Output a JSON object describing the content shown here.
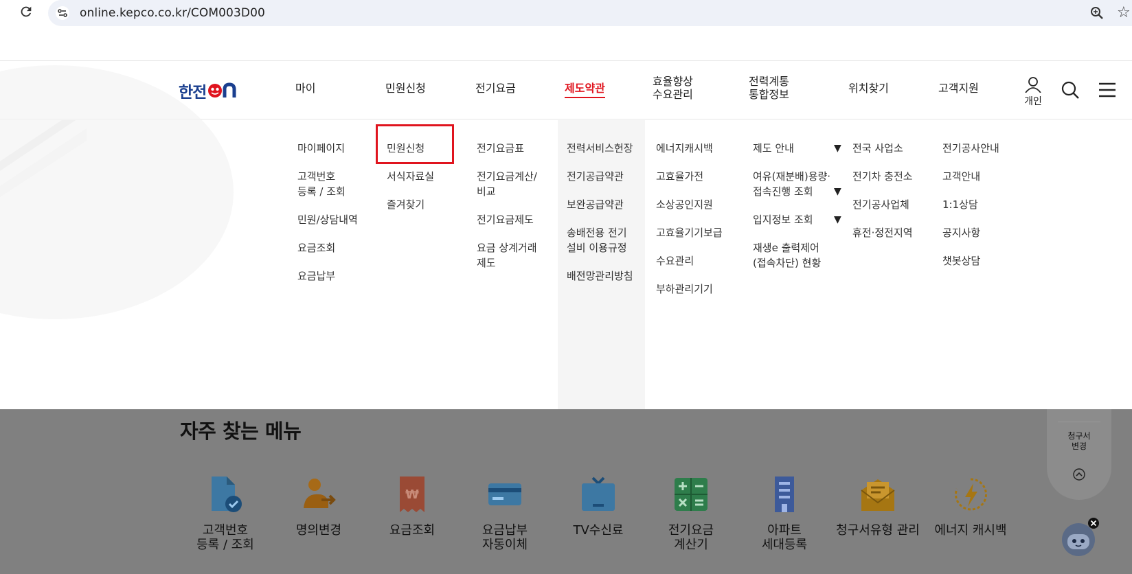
{
  "browser": {
    "url": "online.kepco.co.kr/COM003D00",
    "icons": [
      "reload-icon",
      "site-settings-icon",
      "zoom-icon",
      "bookmark-star-icon"
    ]
  },
  "header": {
    "logo_text": "한전",
    "logo_suffix": "ON",
    "nav": [
      {
        "label": "마이"
      },
      {
        "label": "민원신청"
      },
      {
        "label": "전기요금"
      },
      {
        "label": "제도약관",
        "active": true
      },
      {
        "label_line1": "효율향상",
        "label_line2": "수요관리"
      },
      {
        "label_line1": "전력계통",
        "label_line2": "통합정보"
      },
      {
        "label": "위치찾기"
      },
      {
        "label": "고객지원"
      }
    ],
    "personal_label": "개인",
    "accent_color": "#e0141e",
    "brand_color": "#1a3f8f"
  },
  "mega_menu": {
    "columns": [
      {
        "items": [
          [
            "마이페이지"
          ],
          [
            "고객번호",
            "등록 / 조회"
          ],
          [
            "민원/상담내역"
          ],
          [
            "요금조회"
          ],
          [
            "요금납부"
          ]
        ]
      },
      {
        "items": [
          [
            "민원신청"
          ],
          [
            "서식자료실"
          ],
          [
            "즐겨찾기"
          ]
        ]
      },
      {
        "items": [
          [
            "전기요금표"
          ],
          [
            "전기요금계산/",
            "비교"
          ],
          [
            "전기요금제도"
          ],
          [
            "요금 상계거래",
            "제도"
          ]
        ]
      },
      {
        "items": [
          [
            "전력서비스헌장"
          ],
          [
            "전기공급약관"
          ],
          [
            "보완공급약관"
          ],
          [
            "송배전용 전기",
            "설비 이용규정"
          ],
          [
            "배전망관리방침"
          ]
        ]
      },
      {
        "items": [
          [
            "에너지캐시백"
          ],
          [
            "고효율가전"
          ],
          [
            "소상공인지원"
          ],
          [
            "고효율기기보급"
          ],
          [
            "수요관리"
          ],
          [
            "부하관리기기"
          ]
        ]
      },
      {
        "items": [
          [
            "제도 안내"
          ],
          [
            "여유(재분배)용량·",
            "접속진행 조회"
          ],
          [
            "입지정보 조회"
          ],
          [
            "재생e 출력제어",
            "(접속차단) 현황"
          ]
        ],
        "arrow": "▼"
      },
      {
        "items": [
          [
            "전국 사업소"
          ],
          [
            "전기차 충전소"
          ],
          [
            "전기공사업체"
          ],
          [
            "휴전·정전지역"
          ]
        ]
      },
      {
        "items": [
          [
            "전기공사안내"
          ],
          [
            "고객안내"
          ],
          [
            "1:1상담"
          ],
          [
            "공지사항"
          ],
          [
            "챗봇상담"
          ]
        ]
      }
    ]
  },
  "frequent": {
    "title": "자주 찾는 메뉴",
    "items": [
      {
        "line1": "고객번호",
        "line2": "등록 / 조회",
        "icon": "document-check-icon"
      },
      {
        "line1": "명의변경",
        "line2": "",
        "icon": "person-transfer-icon"
      },
      {
        "line1": "요금조회",
        "line2": "",
        "icon": "won-receipt-icon"
      },
      {
        "line1": "요금납부",
        "line2": "자동이체",
        "icon": "credit-card-icon"
      },
      {
        "line1": "TV수신료",
        "line2": "",
        "icon": "tv-icon"
      },
      {
        "line1": "전기요금",
        "line2": "계산기",
        "icon": "calculator-icon"
      },
      {
        "line1": "아파트",
        "line2": "세대등록",
        "icon": "apartment-icon"
      },
      {
        "line1": "청구서유형 관리",
        "line2": "",
        "icon": "bill-envelope-icon"
      },
      {
        "line1": "에너지 캐시백",
        "line2": "",
        "icon": "energy-cashback-icon"
      }
    ]
  },
  "side_float": {
    "line1": "청구서",
    "line2": "변경"
  }
}
